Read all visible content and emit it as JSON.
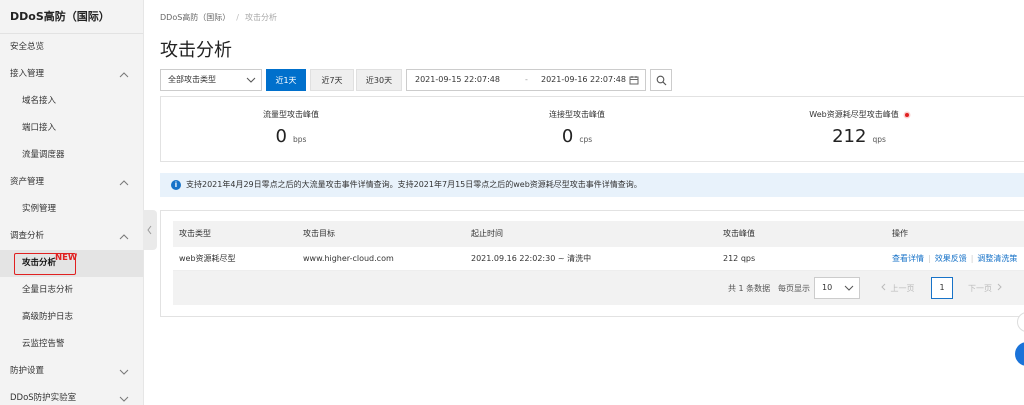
{
  "sidebar": {
    "title": "DDoS高防（国际）",
    "items": [
      {
        "label": "安全总览",
        "type": "top",
        "chevron": ""
      },
      {
        "label": "接入管理",
        "type": "group",
        "chevron": "up"
      },
      {
        "label": "域名接入",
        "type": "sub"
      },
      {
        "label": "端口接入",
        "type": "sub"
      },
      {
        "label": "流量调度器",
        "type": "sub"
      },
      {
        "label": "资产管理",
        "type": "group",
        "chevron": "up"
      },
      {
        "label": "实例管理",
        "type": "sub"
      },
      {
        "label": "调查分析",
        "type": "group",
        "chevron": "up"
      },
      {
        "label": "攻击分析",
        "type": "active",
        "badge": "NEW"
      },
      {
        "label": "全量日志分析",
        "type": "sub"
      },
      {
        "label": "高级防护日志",
        "type": "sub"
      },
      {
        "label": "云监控告警",
        "type": "sub"
      },
      {
        "label": "防护设置",
        "type": "group",
        "chevron": "down"
      },
      {
        "label": "DDoS防护实验室",
        "type": "group",
        "chevron": "down"
      }
    ]
  },
  "breadcrumb": {
    "root": "DDoS高防（国际）",
    "separator": "/",
    "current": "攻击分析"
  },
  "page_title": "攻击分析",
  "toolbar": {
    "attack_type": "全部攻击类型",
    "ranges": [
      {
        "label": "近1天",
        "active": true
      },
      {
        "label": "近7天",
        "active": false
      },
      {
        "label": "近30天",
        "active": false
      }
    ],
    "date_start": "2021-09-15 22:07:48",
    "date_sep": "-",
    "date_end": "2021-09-16 22:07:48"
  },
  "stats": [
    {
      "label": "流量型攻击峰值",
      "value": "0",
      "unit": "bps",
      "dot": false
    },
    {
      "label": "连接型攻击峰值",
      "value": "0",
      "unit": "cps",
      "dot": false
    },
    {
      "label": "Web资源耗尽型攻击峰值",
      "value": "212",
      "unit": "qps",
      "dot": true
    }
  ],
  "notice": "支持2021年4月29日零点之后的大流量攻击事件详情查询。支持2021年7月15日零点之后的web资源耗尽型攻击事件详情查询。",
  "table": {
    "headers": [
      "攻击类型",
      "攻击目标",
      "起止时间",
      "攻击峰值",
      "操作"
    ],
    "rows": [
      {
        "type": "web资源耗尽型",
        "target": "www.higher-cloud.com",
        "time": "2021.09.16 22:02:30 ~ 清洗中",
        "peak": "212 qps",
        "actions": [
          "查看详情",
          "效果反馈",
          "调整清洗策"
        ]
      }
    ]
  },
  "pager": {
    "total": "共 1 条数据",
    "size_label": "每页显示",
    "size": "10",
    "prev": "上一页",
    "current": "1",
    "next": "下一页"
  },
  "colors": {
    "primary": "#0070cc",
    "link": "#1873c8",
    "highlight": "#e02020"
  }
}
